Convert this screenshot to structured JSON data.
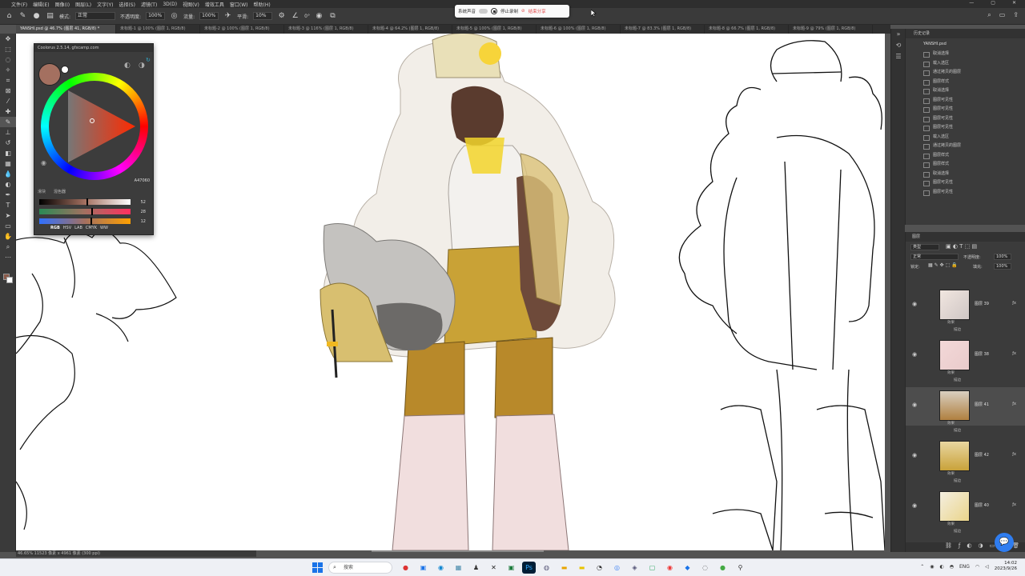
{
  "app": {
    "name": "Adobe Photoshop"
  },
  "menubar": {
    "items": [
      "文件(F)",
      "编辑(E)",
      "图像(I)",
      "图层(L)",
      "文字(Y)",
      "选择(S)",
      "滤镜(T)",
      "3D(D)",
      "视图(V)",
      "增效工具",
      "窗口(W)",
      "帮助(H)"
    ]
  },
  "options_bar": {
    "mode_label": "模式:",
    "mode_value": "正常",
    "opacity_label": "不透明度:",
    "opacity_value": "100%",
    "flow_label": "流量:",
    "flow_value": "100%",
    "smooth_label": "平滑:",
    "smooth_value": "10%",
    "angle_value": "0°"
  },
  "recording_bar": {
    "system_sound": "系统声音",
    "stop_recording": "停止录制",
    "end_share": "结束分享"
  },
  "doc_tabs": [
    {
      "label": "YANSHI.psd @ 46.7% (图层 41, RGB/8) *",
      "active": true
    },
    {
      "label": "未标题-1 @ 100% (图层 1, RGB/8)",
      "active": false
    },
    {
      "label": "未标题-2 @ 100% (图层 1, RGB/8)",
      "active": false
    },
    {
      "label": "未标题-3 @ 116% (图层 1, RGB/8)",
      "active": false
    },
    {
      "label": "未标题-4 @ 64.2% (图层 1, RGB/8)",
      "active": false
    },
    {
      "label": "未标题-5 @ 100% (图层 1, RGB/8)",
      "active": false
    },
    {
      "label": "未标题-6 @ 100% (图层 1, RGB/8)",
      "active": false
    },
    {
      "label": "未标题-7 @ 83.3% (图层 1, RGB/8)",
      "active": false
    },
    {
      "label": "未标题-8 @ 66.7% (图层 1, RGB/8)",
      "active": false
    },
    {
      "label": "未标题-9 @ 79% (图层 1, RGB/8)",
      "active": false
    }
  ],
  "coolorus": {
    "title": "Coolorus 2.5.14, gfxcamp.com",
    "hex": "A47060",
    "current_color": "#a47060",
    "tabs": [
      "滑块",
      "混色器"
    ],
    "sliders": [
      {
        "value": "52",
        "level": 0.52,
        "gradient": "linear-gradient(90deg,#000,#a47060,#ffffff)"
      },
      {
        "value": "28",
        "level": 0.57,
        "gradient": "linear-gradient(90deg,#2a8a55,#a47060,#ff3060)"
      },
      {
        "value": "12",
        "level": 0.56,
        "gradient": "linear-gradient(90deg,#3070ff,#a47060,#ffa000)"
      }
    ],
    "models": [
      "RGB",
      "HSV",
      "LAB",
      "CMYK",
      "WW"
    ]
  },
  "history_panel": {
    "title": "历史记录",
    "root": "YANSHI.psd",
    "items": [
      "取消选择",
      "载入选区",
      "通过拷贝的图层",
      "图层样式",
      "取消选择",
      "图层可见性",
      "图层可见性",
      "图层可见性",
      "图层可见性",
      "载入选区",
      "通过拷贝的图层",
      "图层样式",
      "图层样式",
      "取消选择",
      "图层可见性",
      "图层可见性"
    ]
  },
  "layers_panel": {
    "title": "图层",
    "kind_label": "类型",
    "blend_mode": "正常",
    "opacity_label": "不透明度:",
    "opacity_value": "100%",
    "lock_label": "锁定:",
    "fill_label": "填充:",
    "fill_value": "100%",
    "effects_label": "效果",
    "stroke_label": "描边",
    "layers": [
      {
        "name": "图层 39",
        "thumb": "linear-gradient(135deg,#f1e6e0,#cfc6c4)",
        "selected": false
      },
      {
        "name": "图层 38",
        "thumb": "linear-gradient(135deg,#f3d8d8,#e9cbcb)",
        "selected": false
      },
      {
        "name": "图层 41",
        "thumb": "linear-gradient(180deg,#d9cfc0,#b08040)",
        "selected": true
      },
      {
        "name": "图层 42",
        "thumb": "linear-gradient(180deg,#e8d6a0,#c9a23a)",
        "selected": false
      },
      {
        "name": "图层 40",
        "thumb": "linear-gradient(135deg,#f4efe0,#ead48a)",
        "selected": false
      }
    ]
  },
  "status_bar": {
    "zoom": "46.65%",
    "doc_size": "11523 像素 x 4961 像素 (300 ppi)"
  },
  "taskbar": {
    "search_placeholder": "搜索",
    "lang": "ENG",
    "time": "14:02",
    "date": "2023/9/26"
  }
}
